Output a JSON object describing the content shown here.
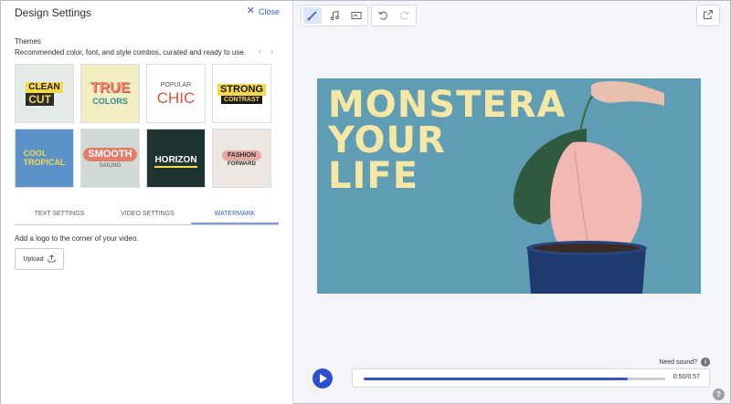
{
  "panel": {
    "title": "Design Settings",
    "close_label": "Close",
    "close_icon": "close-icon"
  },
  "themes": {
    "heading": "Themes",
    "description": "Recommended color, font, and style combos, curated and ready to use.",
    "prev_glyph": "‹",
    "next_glyph": "›",
    "tiles": [
      {
        "lines": [
          "CLEAN",
          "CUT"
        ]
      },
      {
        "lines": [
          "TRUE",
          "COLORS"
        ]
      },
      {
        "lines": [
          "POPULAR",
          "CHIC"
        ]
      },
      {
        "lines": [
          "STRONG",
          "CONTRAST"
        ]
      },
      {
        "lines": [
          "COOL",
          "TROPICAL"
        ]
      },
      {
        "lines": [
          "SMOOTH",
          "SAILING"
        ]
      },
      {
        "lines": [
          "HORIZON"
        ]
      },
      {
        "lines": [
          "FASHION",
          "FORWARD"
        ]
      }
    ]
  },
  "tabs": [
    {
      "label": "TEXT SETTINGS",
      "active": false
    },
    {
      "label": "VIDEO SETTINGS",
      "active": false
    },
    {
      "label": "WATERMARK",
      "active": true
    }
  ],
  "watermark": {
    "description": "Add a logo to the corner of your video.",
    "upload_label": "Upload",
    "upload_icon": "upload-icon"
  },
  "toolbar": {
    "icons": [
      "brush-icon",
      "music-icon",
      "media-icon",
      "undo-icon",
      "redo-icon"
    ],
    "export_icon": "external-link-icon"
  },
  "video": {
    "headline": [
      "MONSTERA",
      "YOUR",
      "LIFE"
    ]
  },
  "player": {
    "need_sound": "Need sound?",
    "time": "0:50/0:57",
    "progress": 0.877
  },
  "colors": {
    "accent": "#3a5ecf",
    "play": "#2f4fcf",
    "headline": "#f6e8a4",
    "video_bg": "#5f9db4"
  }
}
